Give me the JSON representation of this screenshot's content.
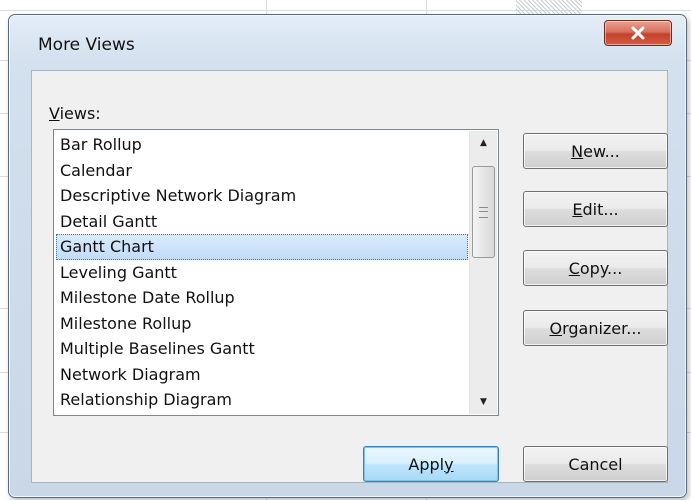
{
  "dialog": {
    "title": "More Views",
    "close_icon": "close-x-icon"
  },
  "views": {
    "label_accel": "V",
    "label_rest": "iews:",
    "items": [
      "Bar Rollup",
      "Calendar",
      "Descriptive Network Diagram",
      "Detail Gantt",
      "Gantt Chart",
      "Leveling Gantt",
      "Milestone Date Rollup",
      "Milestone Rollup",
      "Multiple Baselines Gantt",
      "Network Diagram",
      "Relationship Diagram"
    ],
    "selected": "Gantt Chart",
    "scroll_up_icon": "triangle-up-icon",
    "scroll_down_icon": "triangle-down-icon"
  },
  "buttons": {
    "new": {
      "accel": "N",
      "rest": "ew..."
    },
    "edit": {
      "accel": "E",
      "rest": "dit..."
    },
    "copy": {
      "accel": "C",
      "rest": "opy..."
    },
    "organizer": {
      "accel": "O",
      "rest": "rganizer..."
    },
    "apply": {
      "pre": "Appl",
      "accel": "y"
    },
    "cancel": {
      "label": "Cancel"
    }
  },
  "colors": {
    "selection": "#c1dcfa",
    "close_button": "#c4412b",
    "default_button": "#bee6fd"
  }
}
